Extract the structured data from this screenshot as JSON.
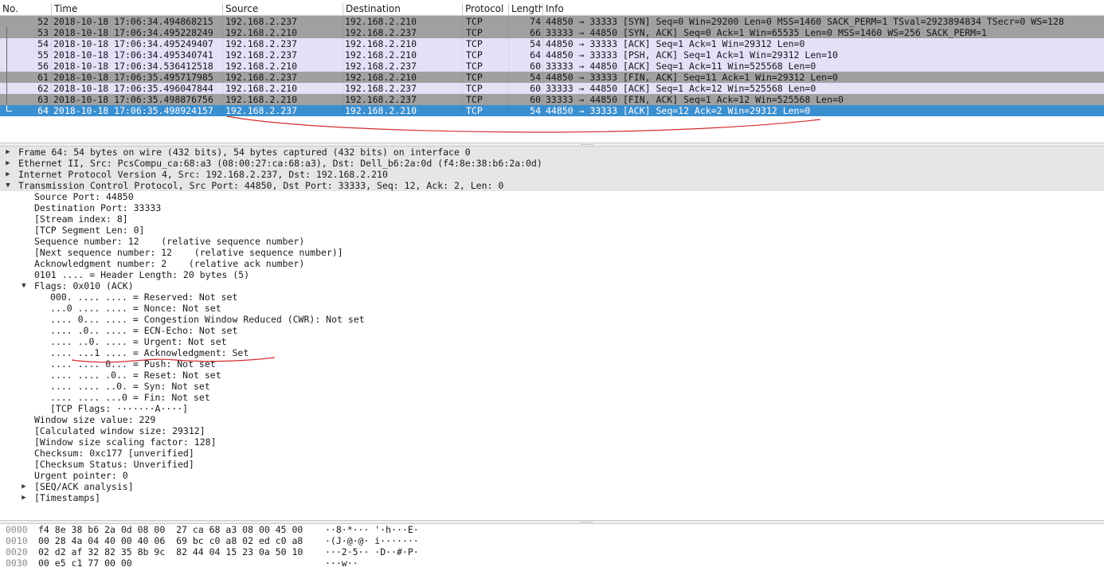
{
  "packet_list": {
    "columns": [
      "No.",
      "Time",
      "Source",
      "Destination",
      "Protocol",
      "Length",
      "Info"
    ],
    "rows": [
      {
        "no": "52",
        "time": "2018-10-18 17:06:34.494868215",
        "src": "192.168.2.237",
        "dst": "192.168.2.210",
        "proto": "TCP",
        "len": "74",
        "info": "44850 → 33333 [SYN] Seq=0 Win=29200 Len=0 MSS=1460 SACK_PERM=1 TSval=2923894834 TSecr=0 WS=128",
        "style": "dark"
      },
      {
        "no": "53",
        "time": "2018-10-18 17:06:34.495228249",
        "src": "192.168.2.210",
        "dst": "192.168.2.237",
        "proto": "TCP",
        "len": "66",
        "info": "33333 → 44850 [SYN, ACK] Seq=0 Ack=1 Win=65535 Len=0 MSS=1460 WS=256 SACK_PERM=1",
        "style": "dark"
      },
      {
        "no": "54",
        "time": "2018-10-18 17:06:34.495249407",
        "src": "192.168.2.237",
        "dst": "192.168.2.210",
        "proto": "TCP",
        "len": "54",
        "info": "44850 → 33333 [ACK] Seq=1 Ack=1 Win=29312 Len=0",
        "style": "light"
      },
      {
        "no": "55",
        "time": "2018-10-18 17:06:34.495340741",
        "src": "192.168.2.237",
        "dst": "192.168.2.210",
        "proto": "TCP",
        "len": "64",
        "info": "44850 → 33333 [PSH, ACK] Seq=1 Ack=1 Win=29312 Len=10",
        "style": "light"
      },
      {
        "no": "56",
        "time": "2018-10-18 17:06:34.536412518",
        "src": "192.168.2.210",
        "dst": "192.168.2.237",
        "proto": "TCP",
        "len": "60",
        "info": "33333 → 44850 [ACK] Seq=1 Ack=11 Win=525568 Len=0",
        "style": "light"
      },
      {
        "no": "61",
        "time": "2018-10-18 17:06:35.495717985",
        "src": "192.168.2.237",
        "dst": "192.168.2.210",
        "proto": "TCP",
        "len": "54",
        "info": "44850 → 33333 [FIN, ACK] Seq=11 Ack=1 Win=29312 Len=0",
        "style": "dark"
      },
      {
        "no": "62",
        "time": "2018-10-18 17:06:35.496047844",
        "src": "192.168.2.210",
        "dst": "192.168.2.237",
        "proto": "TCP",
        "len": "60",
        "info": "33333 → 44850 [ACK] Seq=1 Ack=12 Win=525568 Len=0",
        "style": "light"
      },
      {
        "no": "63",
        "time": "2018-10-18 17:06:35.498876756",
        "src": "192.168.2.210",
        "dst": "192.168.2.237",
        "proto": "TCP",
        "len": "60",
        "info": "33333 → 44850 [FIN, ACK] Seq=1 Ack=12 Win=525568 Len=0",
        "style": "dark"
      },
      {
        "no": "64",
        "time": "2018-10-18 17:06:35.498924157",
        "src": "192.168.2.237",
        "dst": "192.168.2.210",
        "proto": "TCP",
        "len": "54",
        "info": "44850 → 33333 [ACK] Seq=12 Ack=2 Win=29312 Len=0",
        "style": "selected"
      }
    ]
  },
  "details": [
    {
      "indent": 0,
      "exp": "collapsed",
      "text": "Frame 64: 54 bytes on wire (432 bits), 54 bytes captured (432 bits) on interface 0"
    },
    {
      "indent": 0,
      "exp": "collapsed",
      "text": "Ethernet II, Src: PcsCompu_ca:68:a3 (08:00:27:ca:68:a3), Dst: Dell_b6:2a:0d (f4:8e:38:b6:2a:0d)"
    },
    {
      "indent": 0,
      "exp": "collapsed",
      "text": "Internet Protocol Version 4, Src: 192.168.2.237, Dst: 192.168.2.210"
    },
    {
      "indent": 0,
      "exp": "expanded",
      "text": "Transmission Control Protocol, Src Port: 44850, Dst Port: 33333, Seq: 12, Ack: 2, Len: 0"
    },
    {
      "indent": 1,
      "exp": "",
      "text": "Source Port: 44850"
    },
    {
      "indent": 1,
      "exp": "",
      "text": "Destination Port: 33333"
    },
    {
      "indent": 1,
      "exp": "",
      "text": "[Stream index: 8]"
    },
    {
      "indent": 1,
      "exp": "",
      "text": "[TCP Segment Len: 0]"
    },
    {
      "indent": 1,
      "exp": "",
      "text": "Sequence number: 12    (relative sequence number)"
    },
    {
      "indent": 1,
      "exp": "",
      "text": "[Next sequence number: 12    (relative sequence number)]"
    },
    {
      "indent": 1,
      "exp": "",
      "text": "Acknowledgment number: 2    (relative ack number)"
    },
    {
      "indent": 1,
      "exp": "",
      "text": "0101 .... = Header Length: 20 bytes (5)"
    },
    {
      "indent": 1,
      "exp": "expanded",
      "text": "Flags: 0x010 (ACK)"
    },
    {
      "indent": 2,
      "exp": "",
      "text": "000. .... .... = Reserved: Not set"
    },
    {
      "indent": 2,
      "exp": "",
      "text": "...0 .... .... = Nonce: Not set"
    },
    {
      "indent": 2,
      "exp": "",
      "text": ".... 0... .... = Congestion Window Reduced (CWR): Not set"
    },
    {
      "indent": 2,
      "exp": "",
      "text": ".... .0.. .... = ECN-Echo: Not set"
    },
    {
      "indent": 2,
      "exp": "",
      "text": ".... ..0. .... = Urgent: Not set"
    },
    {
      "indent": 2,
      "exp": "",
      "text": ".... ...1 .... = Acknowledgment: Set"
    },
    {
      "indent": 2,
      "exp": "",
      "text": ".... .... 0... = Push: Not set"
    },
    {
      "indent": 2,
      "exp": "",
      "text": ".... .... .0.. = Reset: Not set"
    },
    {
      "indent": 2,
      "exp": "",
      "text": ".... .... ..0. = Syn: Not set"
    },
    {
      "indent": 2,
      "exp": "",
      "text": ".... .... ...0 = Fin: Not set"
    },
    {
      "indent": 2,
      "exp": "",
      "text": "[TCP Flags: ·······A····]"
    },
    {
      "indent": 1,
      "exp": "",
      "text": "Window size value: 229"
    },
    {
      "indent": 1,
      "exp": "",
      "text": "[Calculated window size: 29312]"
    },
    {
      "indent": 1,
      "exp": "",
      "text": "[Window size scaling factor: 128]"
    },
    {
      "indent": 1,
      "exp": "",
      "text": "Checksum: 0xc177 [unverified]"
    },
    {
      "indent": 1,
      "exp": "",
      "text": "[Checksum Status: Unverified]"
    },
    {
      "indent": 1,
      "exp": "",
      "text": "Urgent pointer: 0"
    },
    {
      "indent": 1,
      "exp": "collapsed",
      "text": "[SEQ/ACK analysis]"
    },
    {
      "indent": 1,
      "exp": "collapsed",
      "text": "[Timestamps]"
    }
  ],
  "bytes": [
    {
      "offset": "0000",
      "hex": "f4 8e 38 b6 2a 0d 08 00  27 ca 68 a3 08 00 45 00",
      "ascii": "··8·*··· '·h···E·"
    },
    {
      "offset": "0010",
      "hex": "00 28 4a 04 40 00 40 06  69 bc c0 a8 02 ed c0 a8",
      "ascii": "·(J·@·@· i·······"
    },
    {
      "offset": "0020",
      "hex": "02 d2 af 32 82 35 8b 9c  82 44 04 15 23 0a 50 10",
      "ascii": "···2·5·· ·D··#·P·"
    },
    {
      "offset": "0030",
      "hex": "00 e5 c1 77 00 00",
      "ascii": "···w··"
    }
  ],
  "colors": {
    "row_dark": "#a0a0a0",
    "row_light": "#e4e0f6",
    "row_selected": "#3a8fd0",
    "annotation": "#d62a2a"
  },
  "icons": {
    "expander_collapsed": "▶",
    "expander_expanded": "▼"
  }
}
